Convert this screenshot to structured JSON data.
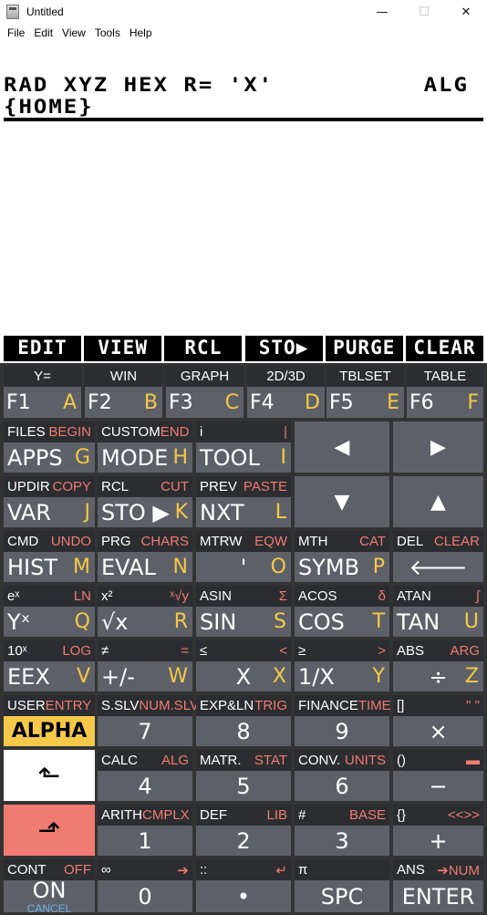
{
  "window": {
    "title": "Untitled",
    "minimize": "—",
    "maximize": "☐",
    "close": "✕"
  },
  "menu": [
    "File",
    "Edit",
    "View",
    "Tools",
    "Help"
  ],
  "screen": {
    "status_line1": "RAD XYZ HEX R= 'X'          ALG",
    "status_line2": "{HOME}",
    "softkeys": [
      "EDIT",
      "VIEW",
      "RCL",
      "STO▶",
      "PURGE",
      "CLEAR"
    ]
  },
  "keys": {
    "f": [
      {
        "top": "Y=",
        "main": "F1",
        "alpha": "A"
      },
      {
        "top": "WIN",
        "main": "F2",
        "alpha": "B"
      },
      {
        "top": "GRAPH",
        "main": "F3",
        "alpha": "C"
      },
      {
        "top": "2D/3D",
        "main": "F4",
        "alpha": "D"
      },
      {
        "top": "TBLSET",
        "main": "F5",
        "alpha": "E"
      },
      {
        "top": "TABLE",
        "main": "F6",
        "alpha": "F"
      }
    ],
    "row2": [
      {
        "l": "FILES",
        "r": "BEGIN",
        "main": "APPS",
        "alpha": "G"
      },
      {
        "l": "CUSTOM",
        "r": "END",
        "main": "MODE",
        "alpha": "H"
      },
      {
        "l": "i",
        "r": "|",
        "main": "TOOL",
        "alpha": "I"
      }
    ],
    "row3": [
      {
        "l": "UPDIR",
        "r": "COPY",
        "main": "VAR",
        "alpha": "J"
      },
      {
        "l": "RCL",
        "r": "CUT",
        "main": "STO ▶",
        "alpha": "K"
      },
      {
        "l": "PREV",
        "r": "PASTE",
        "main": "NXT",
        "alpha": "L"
      }
    ],
    "arrows": {
      "left": "◀",
      "right": "▶",
      "down": "▼",
      "up": "▲"
    },
    "row4": [
      {
        "l": "CMD",
        "r": "UNDO",
        "main": "HIST",
        "alpha": "M"
      },
      {
        "l": "PRG",
        "r": "CHARS",
        "main": "EVAL",
        "alpha": "N"
      },
      {
        "l": "MTRW",
        "r": "EQW",
        "main": "'",
        "alpha": "O"
      },
      {
        "l": "MTH",
        "r": "CAT",
        "main": "SYMB",
        "alpha": "P"
      },
      {
        "l": "DEL",
        "r": "CLEAR",
        "main": "🡐",
        "alpha": ""
      }
    ],
    "row5": [
      {
        "l": "eˣ",
        "r": "LN",
        "main": "Yˣ",
        "alpha": "Q"
      },
      {
        "l": "x²",
        "r": "ˣ√y",
        "main": "√x",
        "alpha": "R"
      },
      {
        "l": "ASIN",
        "r": "Σ",
        "main": "SIN",
        "alpha": "S"
      },
      {
        "l": "ACOS",
        "r": "δ",
        "main": "COS",
        "alpha": "T"
      },
      {
        "l": "ATAN",
        "r": "∫",
        "main": "TAN",
        "alpha": "U"
      }
    ],
    "row6": [
      {
        "l": "10ˣ",
        "r": "LOG",
        "main": "EEX",
        "alpha": "V"
      },
      {
        "l": "≠",
        "r": "=",
        "main": "+/-",
        "alpha": "W"
      },
      {
        "l": "≤",
        "r": "<",
        "main": "X",
        "alpha": "X"
      },
      {
        "l": "≥",
        "r": ">",
        "main": "1/X",
        "alpha": "Y"
      },
      {
        "l": "ABS",
        "r": "ARG",
        "main": "÷",
        "alpha": "Z"
      }
    ],
    "row7": [
      {
        "l": "USER",
        "r": "ENTRY",
        "main": "ALPHA"
      },
      {
        "l": "S.SLV",
        "r": "NUM.SLV",
        "main": "7"
      },
      {
        "l": "EXP&LN",
        "r": "TRIG",
        "main": "8"
      },
      {
        "l": "FINANCE",
        "r": "TIME",
        "main": "9"
      },
      {
        "l": "[]",
        "r": "\" \"",
        "main": "×"
      }
    ],
    "row8": [
      {
        "main": "⬑"
      },
      {
        "l": "CALC",
        "r": "ALG",
        "main": "4"
      },
      {
        "l": "MATR.",
        "r": "STAT",
        "main": "5"
      },
      {
        "l": "CONV.",
        "r": "UNITS",
        "main": "6"
      },
      {
        "l": "()",
        "r": "▬",
        "main": "−"
      }
    ],
    "row9": [
      {
        "main": "⬏"
      },
      {
        "l": "ARITH",
        "r": "CMPLX",
        "main": "1"
      },
      {
        "l": "DEF",
        "r": "LIB",
        "main": "2"
      },
      {
        "l": "#",
        "r": "BASE",
        "main": "3"
      },
      {
        "l": "{}",
        "r": "<<>>",
        "main": "+"
      }
    ],
    "row10": [
      {
        "l": "CONT",
        "r": "OFF",
        "main": "ON",
        "sub": "CANCEL"
      },
      {
        "l": "∞",
        "r": "➔",
        "main": "0"
      },
      {
        "l": "::",
        "r": "↵",
        "main": "•"
      },
      {
        "l": "π",
        "r": "",
        "main": "SPC"
      },
      {
        "l": "ANS",
        "r": "➔NUM",
        "main": "ENTER"
      }
    ]
  },
  "colors": {
    "key_bg": "#5d6167",
    "key_top": "#2b2d31",
    "alpha_letter": "#f5c84a",
    "right_shift": "#f07b70",
    "left_shift": "#ffffff"
  }
}
